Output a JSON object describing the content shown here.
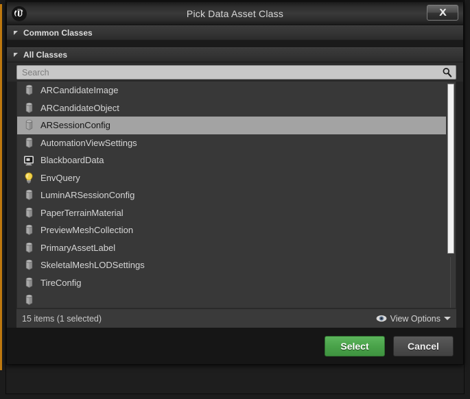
{
  "window": {
    "title": "Pick Data Asset Class",
    "logo_icon": "unreal-engine-logo-icon",
    "close_icon": "close-icon",
    "close_label": "Close"
  },
  "sections": [
    {
      "label": "Common Classes",
      "expander_icon": "triangle-expanded-icon",
      "expanded": true
    },
    {
      "label": "All Classes",
      "expander_icon": "triangle-expanded-icon",
      "expanded": true
    }
  ],
  "search": {
    "value": "",
    "placeholder": "Search",
    "icon": "search-icon"
  },
  "class_list": {
    "items": [
      {
        "name": "ARCandidateImage",
        "icon": "data-asset-icon",
        "selected": false
      },
      {
        "name": "ARCandidateObject",
        "icon": "data-asset-icon",
        "selected": false
      },
      {
        "name": "ARSessionConfig",
        "icon": "data-asset-icon",
        "selected": true
      },
      {
        "name": "AutomationViewSettings",
        "icon": "data-asset-icon",
        "selected": false
      },
      {
        "name": "BlackboardData",
        "icon": "blackboard-icon",
        "selected": false
      },
      {
        "name": "EnvQuery",
        "icon": "lightbulb-icon",
        "selected": false
      },
      {
        "name": "LuminARSessionConfig",
        "icon": "data-asset-icon",
        "selected": false
      },
      {
        "name": "PaperTerrainMaterial",
        "icon": "data-asset-icon",
        "selected": false
      },
      {
        "name": "PreviewMeshCollection",
        "icon": "data-asset-icon",
        "selected": false
      },
      {
        "name": "PrimaryAssetLabel",
        "icon": "data-asset-icon",
        "selected": false
      },
      {
        "name": "SkeletalMeshLODSettings",
        "icon": "data-asset-icon",
        "selected": false
      },
      {
        "name": "TireConfig",
        "icon": "data-asset-icon",
        "selected": false
      }
    ]
  },
  "status": {
    "text": "15 items (1 selected)",
    "view_options_label": "View Options",
    "view_options_icon": "eye-icon",
    "caret_icon": "caret-down-icon"
  },
  "footer": {
    "select_label": "Select",
    "cancel_label": "Cancel"
  },
  "colors": {
    "accent": "#c07a10",
    "primary_button": "#48a148",
    "selection": "#a3a3a3",
    "dialog_bg": "#222222",
    "list_bg": "#383838"
  }
}
